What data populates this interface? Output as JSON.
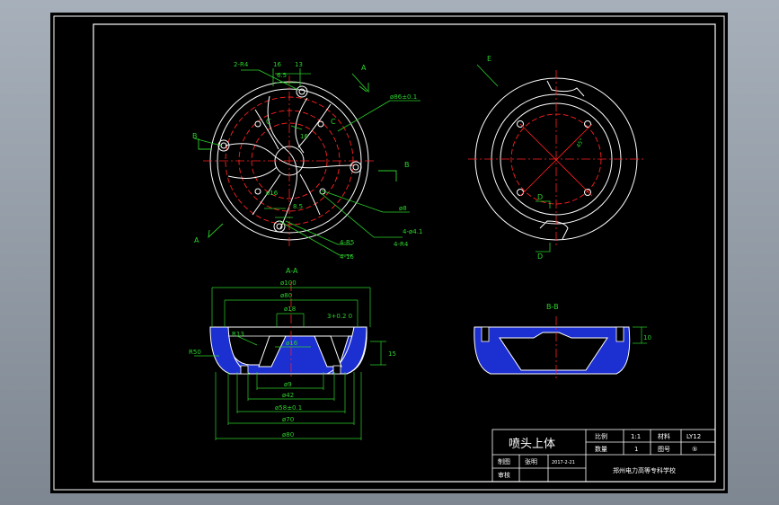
{
  "colors": {
    "outline": "#ffffff",
    "dimension": "#2bd12b",
    "centerline": "#ff2020",
    "section_fill": "#1c2fd0",
    "hatch": "#6aa0ff",
    "border": "#ffffff"
  },
  "views": {
    "front": {
      "labels": {
        "d1": "2-R4",
        "d2": "16",
        "d3": "13",
        "d4": "6.5",
        "d5": "ø86±0.1",
        "d6": "C",
        "d7": "C",
        "d8": "16",
        "d9": "ø16",
        "d10": "8.5",
        "d11": "ø8",
        "d12": "4-ø4.1",
        "d13": "4-R4",
        "d14": "4-R5",
        "d15": "4-16",
        "a1": "A",
        "a2": "A",
        "b1": "B",
        "b2": "B"
      }
    },
    "side": {
      "labels": {
        "e": "E",
        "d1": "D",
        "d2": "D",
        "angle": "45°"
      }
    },
    "section_aa": {
      "title": "A-A",
      "dims": {
        "d100": "ø100",
        "d80": "ø80",
        "d18": "ø18",
        "dep": "3+0.2\n 0",
        "r13": "R13",
        "r50": "R50",
        "d16": "ø16",
        "h": "15",
        "d9": "ø9",
        "d42": "ø42",
        "d58": "ø58±0.1",
        "d70": "ø70",
        "d80b": "ø80"
      }
    },
    "section_bb": {
      "title": "B-B",
      "dims": {
        "h": "10"
      }
    }
  },
  "title_block": {
    "part_name": "喷头上体",
    "scale_label": "比例",
    "scale_value": "1:1",
    "material_label": "材料",
    "material_value": "LY12",
    "qty_label": "数量",
    "qty_value": "1",
    "drawing_no_label": "图号",
    "drawing_no_value": "⑤",
    "drawn_label": "制图",
    "drawn_name": "张明",
    "drawn_date": "2017-2-21",
    "checked_label": "审核",
    "school": "郑州电力高等专科学校"
  }
}
